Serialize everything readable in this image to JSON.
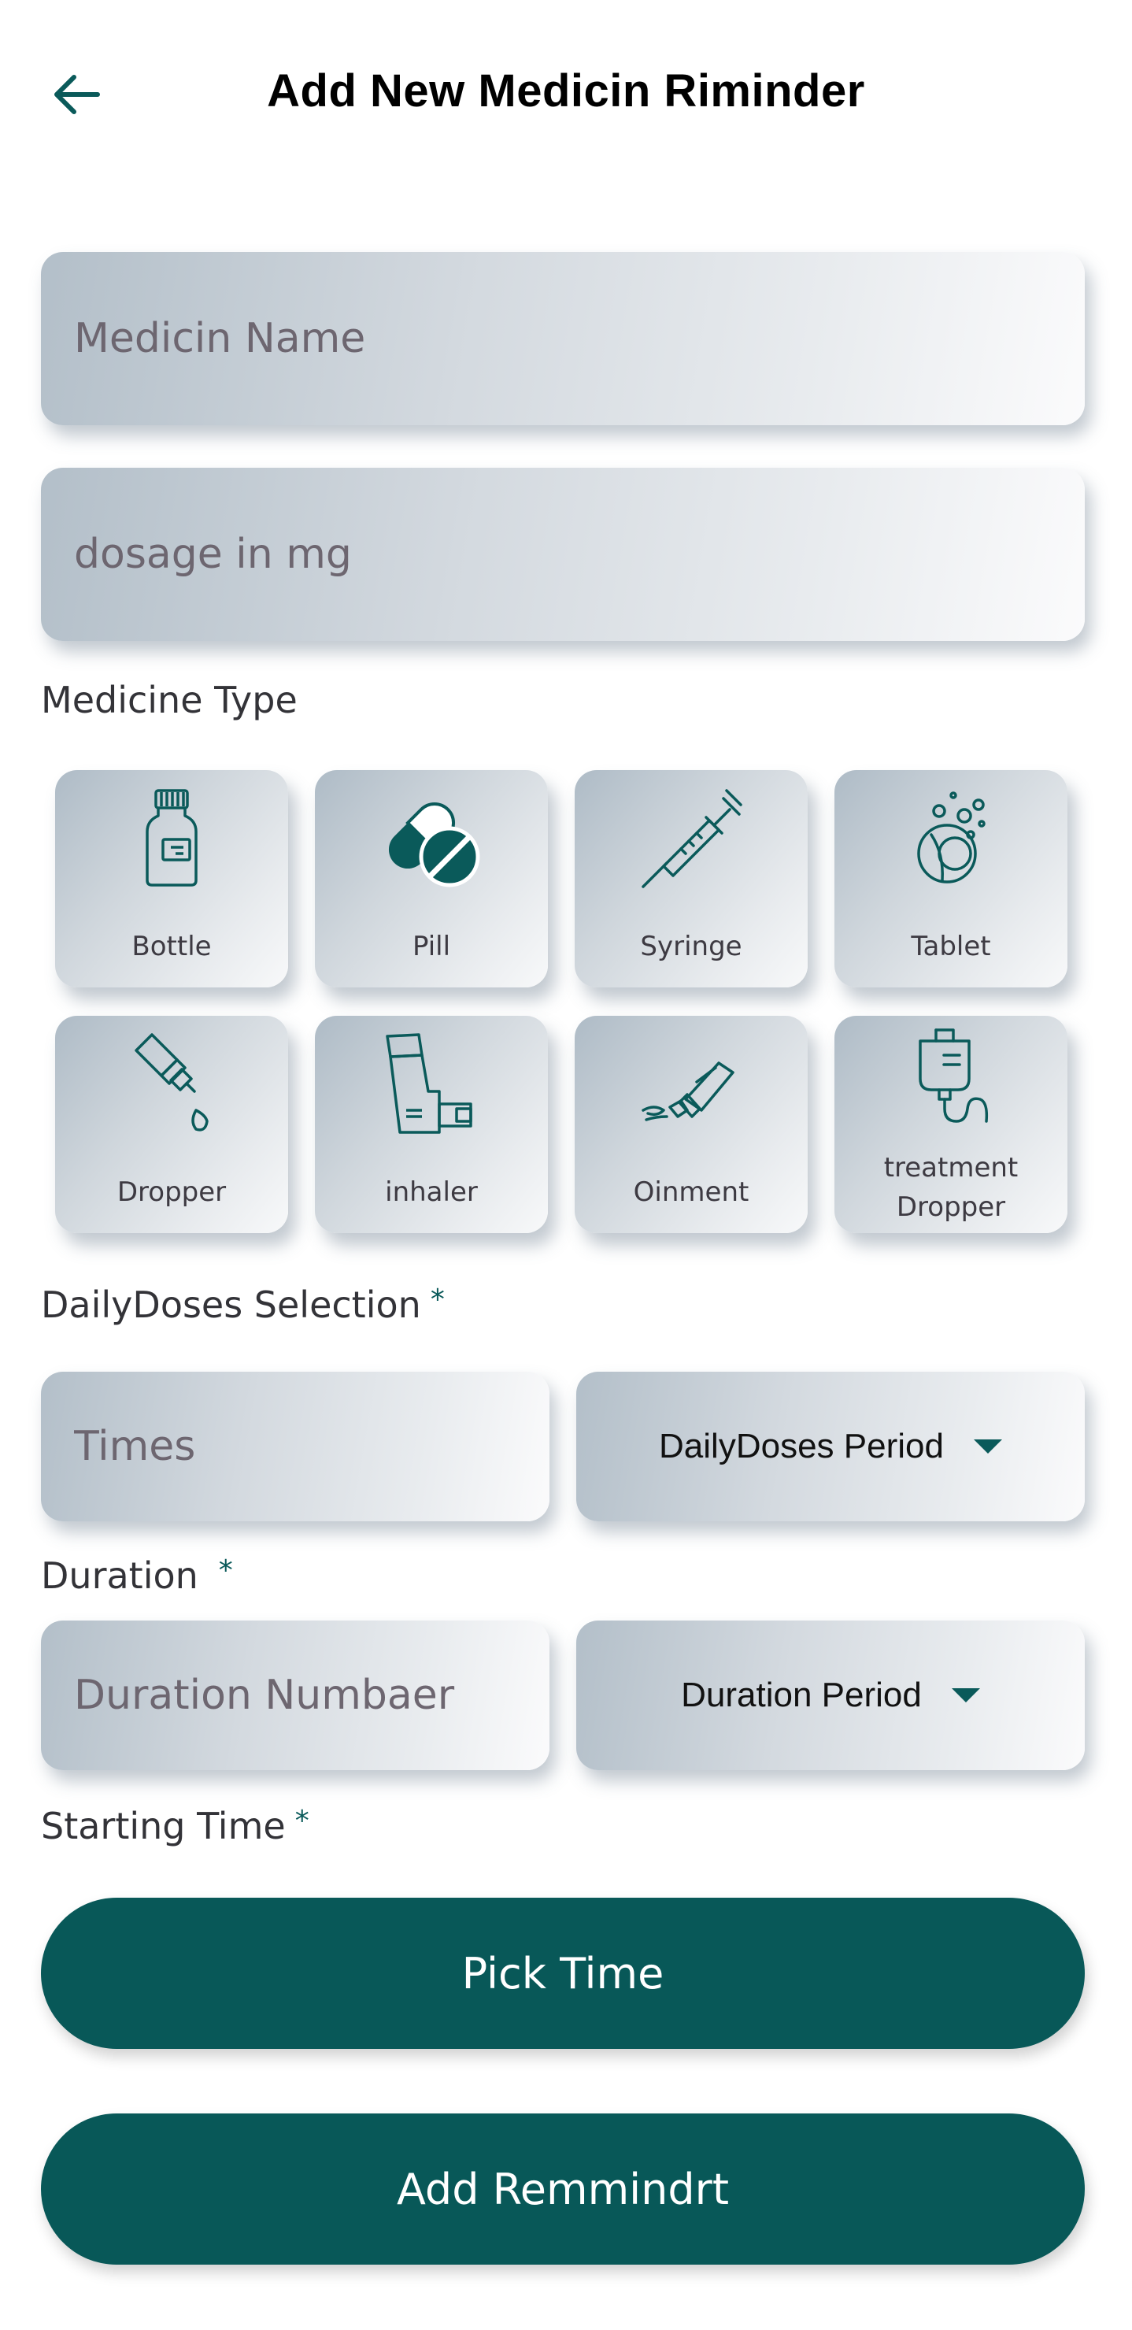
{
  "header": {
    "title": "Add New Medicin Riminder"
  },
  "form": {
    "medicine_name_placeholder": "Medicin Name",
    "dosage_placeholder": "dosage in mg",
    "medicine_type_label": "Medicine Type",
    "types": [
      {
        "label": "Bottle",
        "icon": "bottle-icon"
      },
      {
        "label": "Pill",
        "icon": "pill-icon"
      },
      {
        "label": "Syringe",
        "icon": "syringe-icon"
      },
      {
        "label": "Tablet",
        "icon": "tablet-icon"
      },
      {
        "label": "Dropper",
        "icon": "dropper-icon"
      },
      {
        "label": "inhaler",
        "icon": "inhaler-icon"
      },
      {
        "label": "Oinment",
        "icon": "ointment-icon"
      },
      {
        "label": "treatment\nDropper",
        "label_line1": "treatment",
        "label_line2": "Dropper",
        "icon": "iv-drip-icon"
      }
    ],
    "daily_doses_label": "DailyDoses Selection",
    "times_placeholder": "Times",
    "daily_doses_period": "DailyDoses Period",
    "duration_label": "Duration",
    "duration_placeholder": "Duration Numbaer",
    "duration_period": "Duration Period",
    "starting_time_label": "Starting Time",
    "required_mark": "*",
    "pick_time_label": "Pick Time",
    "add_reminder_label": "Add Remmindrt"
  },
  "colors": {
    "primary": "#085858",
    "field_gradient_start": "#b3bfc9",
    "field_gradient_end": "#fbfbfc",
    "placeholder": "#6d6670"
  }
}
